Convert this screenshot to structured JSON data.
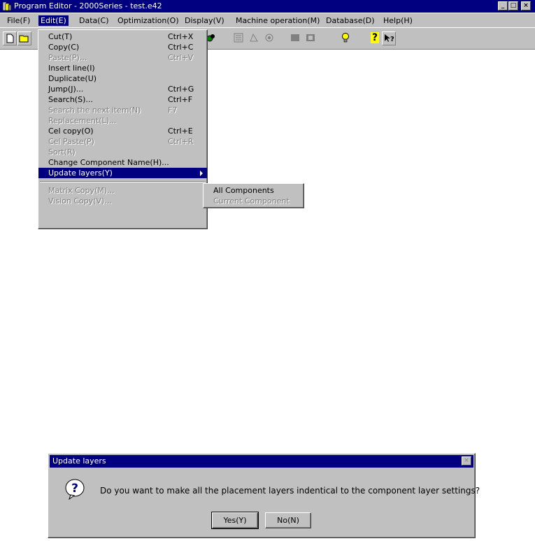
{
  "window": {
    "title": "Program Editor - 2000Series - test.e42",
    "minimize": "_",
    "maximize": "□",
    "close": "×"
  },
  "menubar": [
    "File(F)",
    "Edit(E)",
    "Data(C)",
    "Optimization(O)",
    "Display(V)",
    "Machine operation(M)",
    "Database(D)",
    "Help(H)"
  ],
  "toolbar_icons": [
    "new-file-icon",
    "open-folder-icon",
    "component-icon",
    "layout-icon",
    "image-icon",
    "settings-icon",
    "left-align-icon",
    "right-align-icon",
    "bulb-icon",
    "help-icon",
    "context-help-icon"
  ],
  "edit_menu": {
    "items": [
      {
        "label": "Cut(T)",
        "shortcut": "Ctrl+X"
      },
      {
        "label": "Copy(C)",
        "shortcut": "Ctrl+C"
      },
      {
        "label": "Paste(P)...",
        "shortcut": "Ctrl+V"
      },
      {
        "label": "Insert line(I)",
        "shortcut": ""
      },
      {
        "label": "Duplicate(U)",
        "shortcut": ""
      },
      {
        "label": "Jump(J)...",
        "shortcut": "Ctrl+G"
      },
      {
        "label": "Search(S)...",
        "shortcut": "Ctrl+F"
      },
      {
        "label": "Search the next item(N)",
        "shortcut": "F7"
      },
      {
        "label": "Replacement(L)...",
        "shortcut": ""
      },
      {
        "label": "Cel copy(O)",
        "shortcut": "Ctrl+E"
      },
      {
        "label": "Cel Paste(P)",
        "shortcut": "Ctrl+R"
      },
      {
        "label": "Sort(R)",
        "shortcut": ""
      },
      {
        "label": "Change Component Name(H)...",
        "shortcut": ""
      },
      {
        "label": "Update layers(Y)",
        "shortcut": ""
      },
      {
        "label": "Matrix Copy(M)...",
        "shortcut": ""
      },
      {
        "label": "Vision Copy(V)...",
        "shortcut": ""
      }
    ]
  },
  "submenu": {
    "items": [
      {
        "label": "All Components"
      },
      {
        "label": "Current Component"
      }
    ]
  },
  "dialog": {
    "title": "Update layers",
    "close": "×",
    "message": "Do you want to make all the placement layers indentical to the component layer settings?",
    "icon_glyph": "?",
    "yes_label": "Yes(Y)",
    "no_label": "No(N)"
  }
}
